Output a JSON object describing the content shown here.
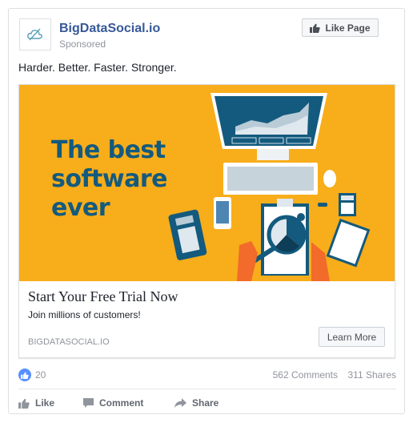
{
  "post": {
    "page_name": "BigDataSocial.io",
    "sponsored_label": "Sponsored",
    "like_page_label": "Like Page",
    "message": "Harder. Better. Faster. Stronger.",
    "colors": {
      "brand_link": "#365899",
      "hero_bg": "#f8ad1a",
      "hero_text": "#135a7e",
      "like_blue": "#5890ff"
    }
  },
  "attachment": {
    "hero_lines": [
      "The best",
      "software",
      "ever"
    ],
    "title": "Start Your Free Trial Now",
    "description": "Join millions of customers!",
    "domain": "BIGDATASOCIAL.IO",
    "cta_label": "Learn More"
  },
  "stats": {
    "likes": "20",
    "comments": "562 Comments",
    "shares": "311 Shares"
  },
  "actions": {
    "like": "Like",
    "comment": "Comment",
    "share": "Share"
  }
}
